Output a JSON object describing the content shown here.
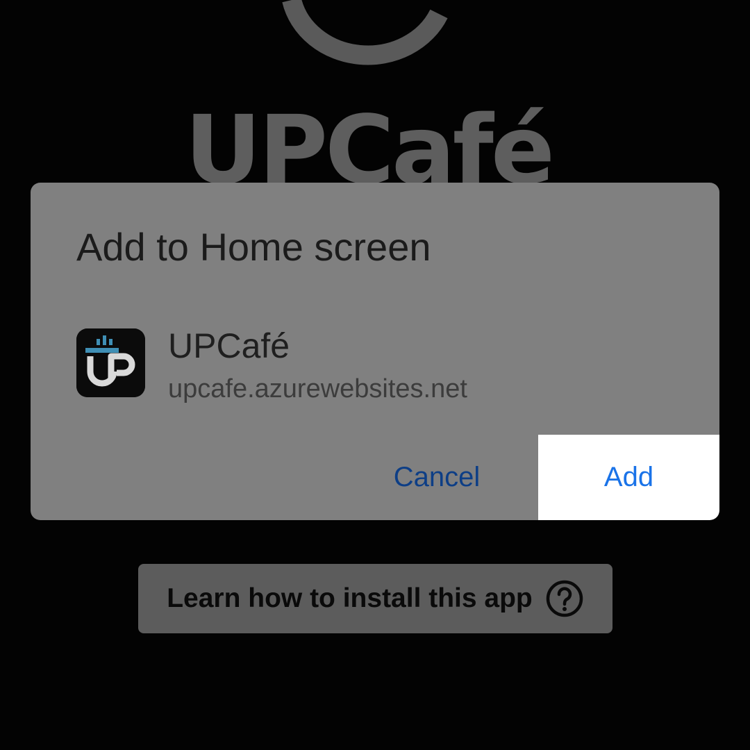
{
  "background": {
    "brand_text": "UPCafé",
    "learn_button_label": "Learn how to install this app",
    "help_icon": "question-circle-icon"
  },
  "dialog": {
    "title": "Add to Home screen",
    "app_icon": "upcafe-app-icon",
    "app_name": "UPCafé",
    "app_url": "upcafe.azurewebsites.net",
    "cancel_label": "Cancel",
    "add_label": "Add"
  },
  "colors": {
    "dialog_bg": "#808080",
    "add_button_bg": "#ffffff",
    "add_text": "#1a73e8",
    "cancel_text": "#0d3e86",
    "icon_accent": "#3f8fb5"
  }
}
